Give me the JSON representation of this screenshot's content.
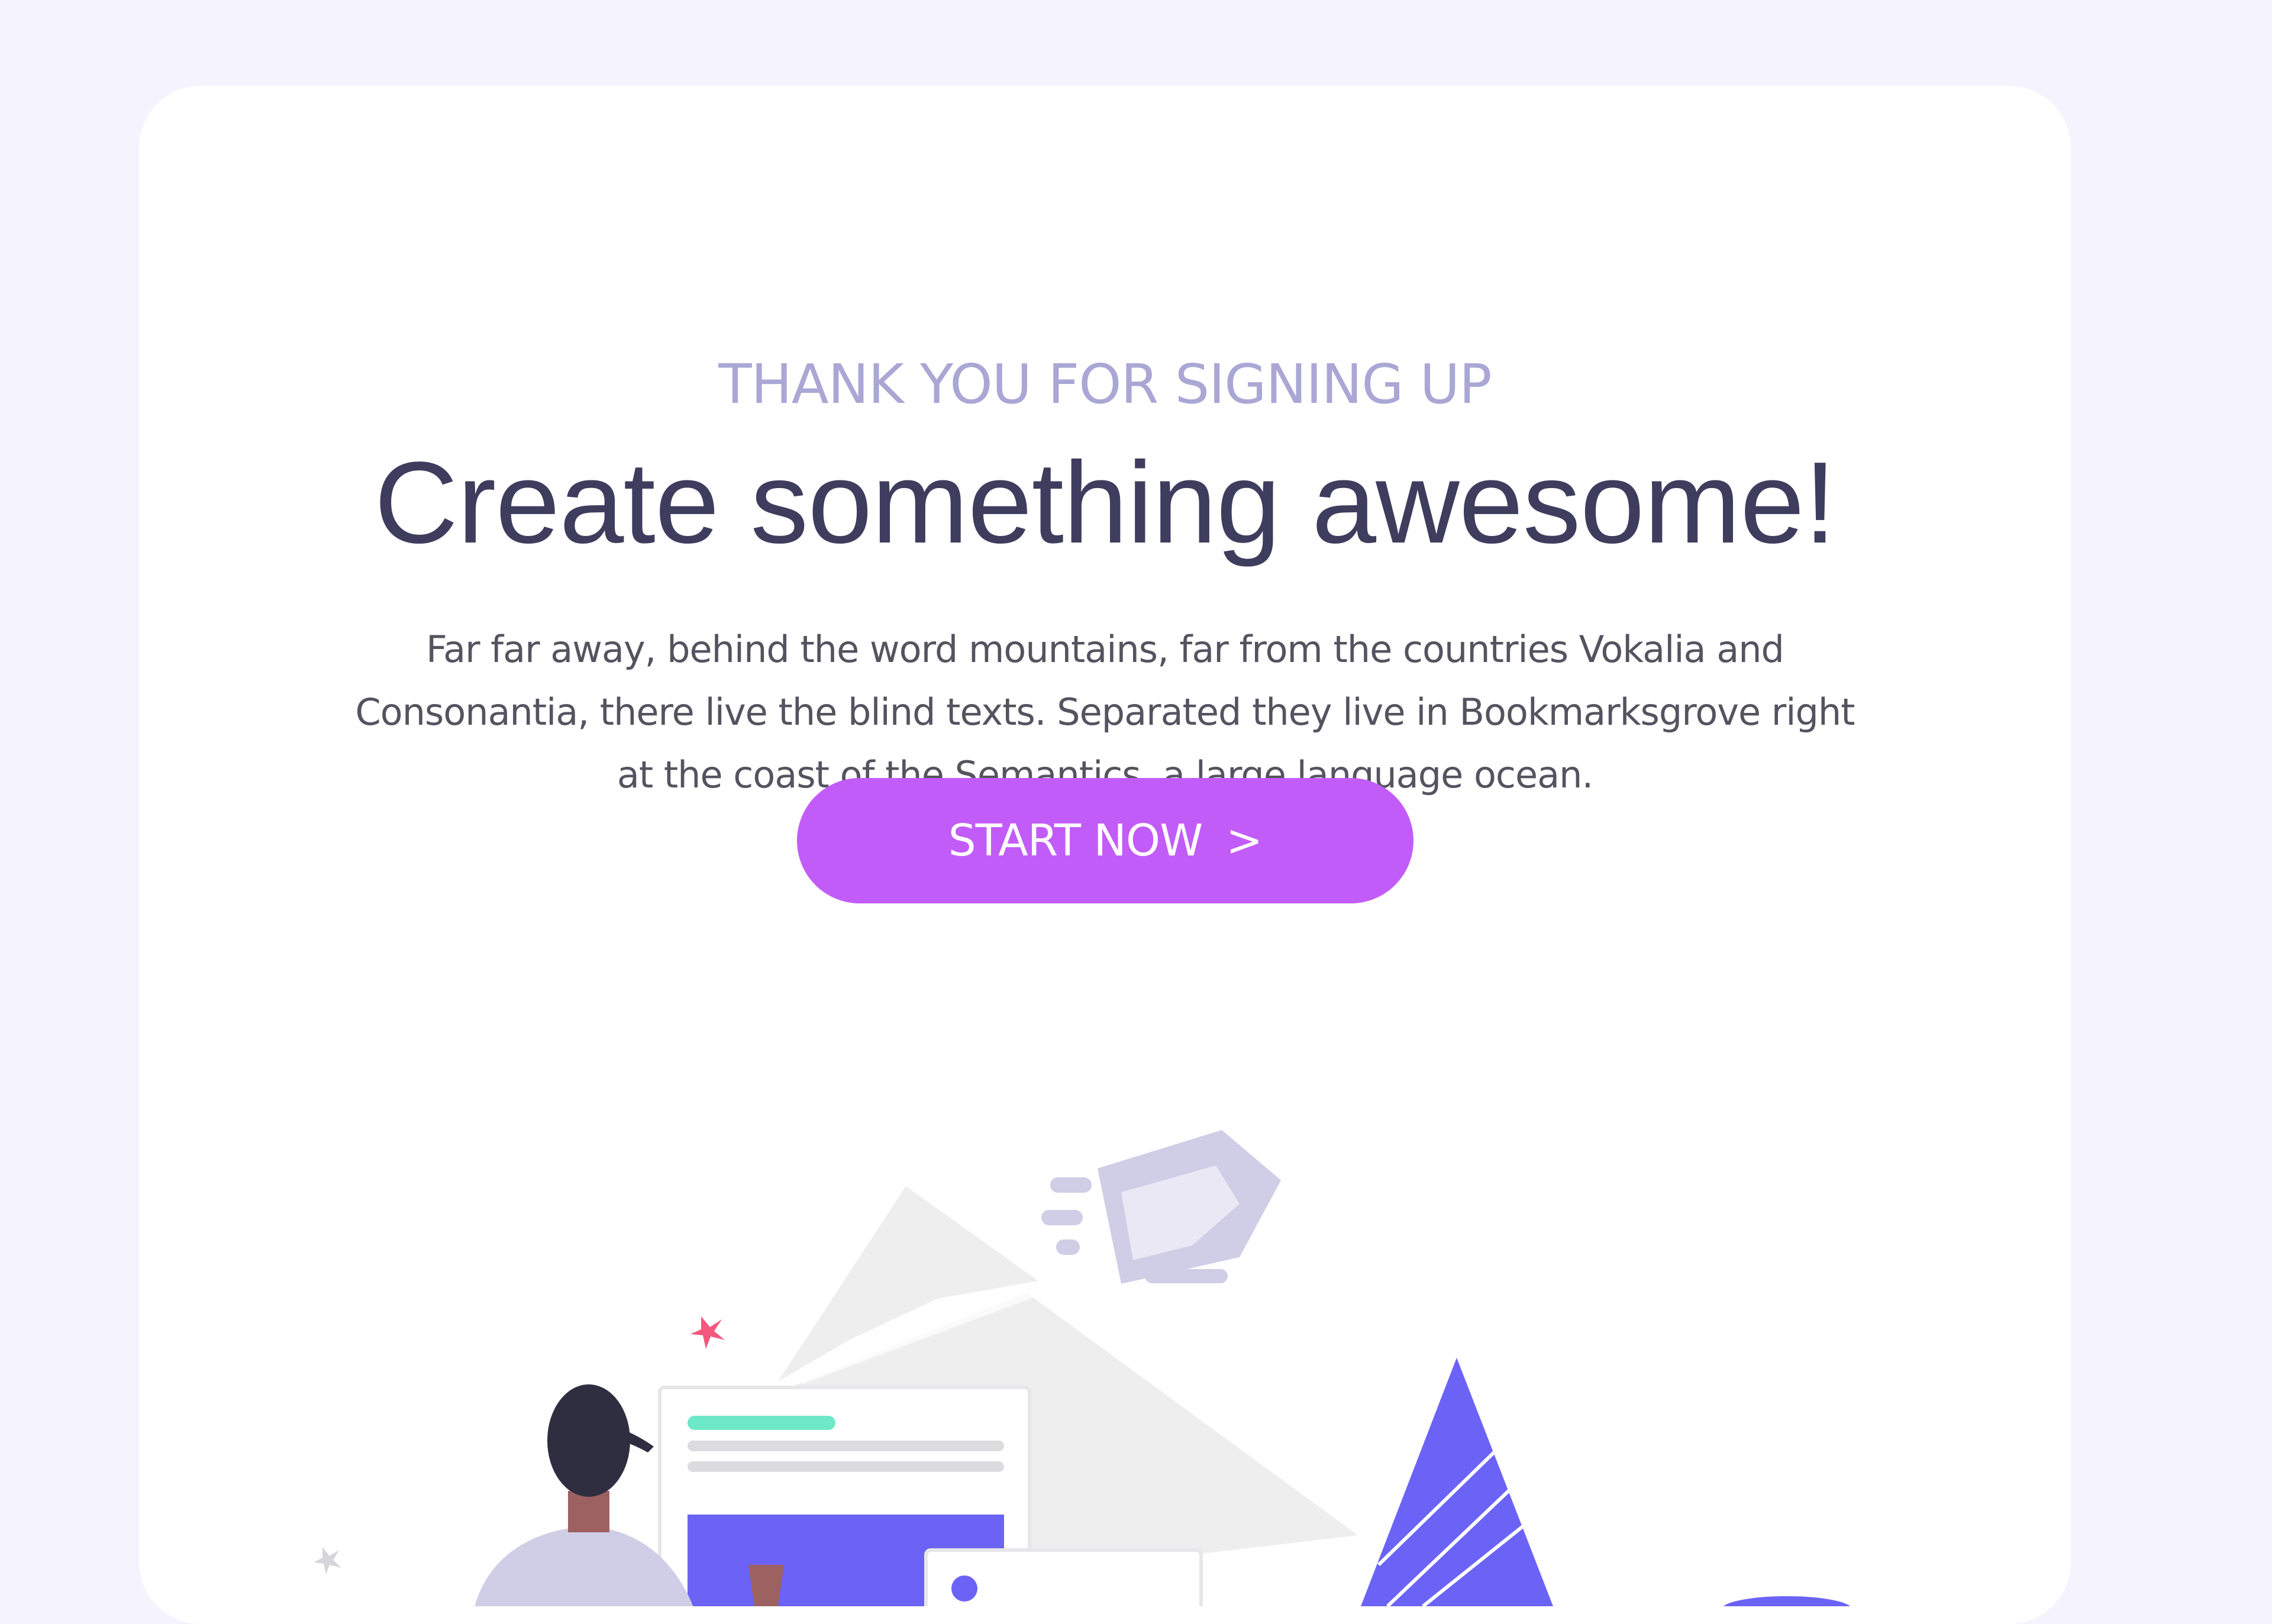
{
  "hero": {
    "eyebrow": "THANK YOU FOR SIGNING UP",
    "headline": "Create something awesome!",
    "body": "Far far away, behind the word mountains, far from the countries Vokalia and Consonantia, there live the blind texts. Separated they live in Bookmarksgrove right at the coast of the Semantics, a large language ocean.",
    "cta_label": "START NOW",
    "cta_chevron": ">"
  },
  "colors": {
    "page_background": "#f4f3fe",
    "card_background": "#ffffff",
    "eyebrow": "#aaa7d5",
    "headline": "#3f3d5e",
    "body": "#55535f",
    "cta_background": "#c25cf9",
    "illustration_accent": "#6b63f6",
    "illustration_secondary": "#d0cde6",
    "illustration_mint": "#6de9c9",
    "illustration_pink": "#f5577d"
  },
  "illustration": {
    "icons": [
      "person-icon",
      "webpage-mockup-icon",
      "rocket-icon",
      "mountain-icon",
      "pine-tree-icon",
      "sparkle-icon"
    ]
  }
}
